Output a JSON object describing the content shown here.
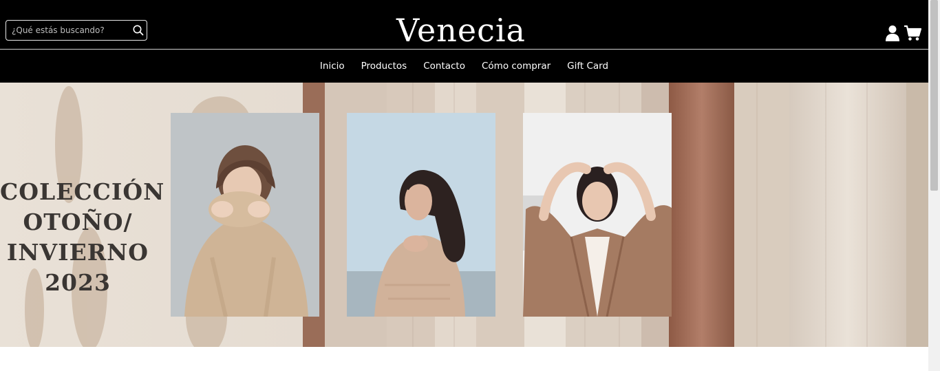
{
  "header": {
    "search": {
      "placeholder": "¿Qué estás buscando?",
      "value": ""
    },
    "logo": "Venecia",
    "icons": [
      "search-icon",
      "user-icon",
      "cart-icon"
    ]
  },
  "nav": {
    "items": [
      {
        "label": "Inicio"
      },
      {
        "label": "Productos"
      },
      {
        "label": "Contacto"
      },
      {
        "label": "Cómo comprar"
      },
      {
        "label": "Gift Card"
      }
    ]
  },
  "hero": {
    "title_lines": [
      "COLECCIÓN",
      "OTOÑO/",
      "INVIERNO",
      "2023"
    ]
  },
  "colors": {
    "header_bg": "#000000",
    "header_text": "#ffffff",
    "hero_text": "#3a3633"
  }
}
